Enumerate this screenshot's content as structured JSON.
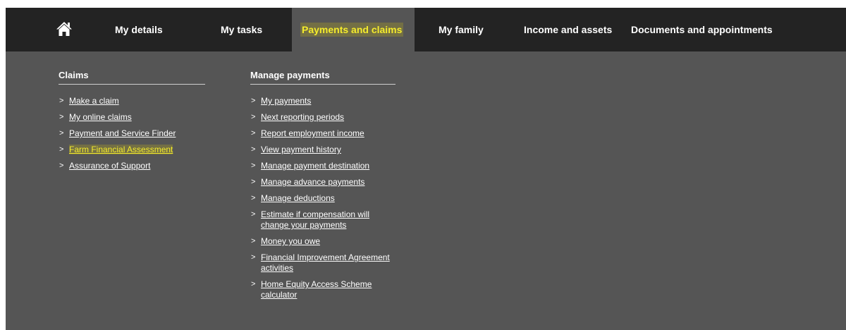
{
  "nav": {
    "home_icon": "home-icon",
    "items": [
      {
        "label": "My details"
      },
      {
        "label": "My tasks"
      },
      {
        "label": "Payments and claims"
      },
      {
        "label": "My family"
      },
      {
        "label": "Income and assets"
      },
      {
        "label": "Documents and appointments"
      }
    ],
    "active": "Payments and claims"
  },
  "claims": {
    "heading": "Claims",
    "links": [
      "Make a claim",
      "My online claims",
      "Payment and Service Finder",
      "Farm Financial Assessment",
      "Assurance of Support"
    ]
  },
  "payments": {
    "heading": "Manage payments",
    "links": [
      "My payments",
      "Next reporting periods",
      "Report employment income",
      "View payment history",
      "Manage payment destination",
      "Manage advance payments",
      "Manage deductions",
      "Estimate if compensation will change your payments",
      "Money you owe",
      "Financial Improvement Agreement activities",
      "Home Equity Access Scheme calculator"
    ]
  },
  "colors": {
    "nav_bg": "#232323",
    "panel_bg": "#555555",
    "highlight": "#f5ec2c"
  },
  "bullet": ">"
}
